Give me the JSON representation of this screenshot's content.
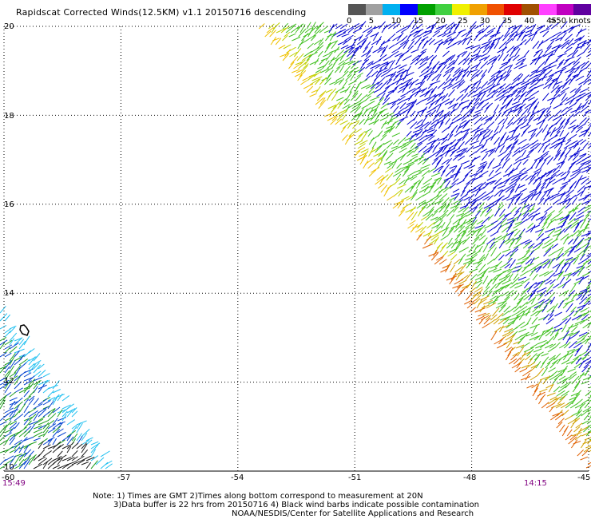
{
  "title": "Rapidscat Corrected Winds(12.5KM) v1.1 20150716 descending",
  "legend": {
    "colors": [
      "#555555",
      "#a0a0a0",
      "#00b0f0",
      "#0000ff",
      "#00a000",
      "#40d040",
      "#f0f000",
      "#f0a000",
      "#f05000",
      "#e00000",
      "#a05000",
      "#ff40ff",
      "#c000c0",
      "#6000a0"
    ],
    "labels": [
      "0",
      "5",
      "10",
      "15",
      "20",
      "25",
      "30",
      "35",
      "40",
      "45",
      ">50 knots"
    ]
  },
  "axes": {
    "x_ticks": [
      "-60",
      "-57",
      "-54",
      "-51",
      "-48",
      "-45"
    ],
    "y_ticks": [
      "10",
      "12",
      "14",
      "16",
      "18",
      "20"
    ],
    "lon_range": [
      -60,
      -45
    ],
    "lat_range": [
      10,
      20
    ]
  },
  "times": {
    "left": "15:49",
    "right": "14:15"
  },
  "notes": {
    "line1": "Note: 1) Times are GMT 2)Times along bottom correspond to measurement at 20N",
    "line2": "3)Data buffer is 22 hrs from 20150716 4) Black wind barbs indicate possible contamination",
    "line3": "NOAA/NESDIS/Center for Satellite Applications and Research"
  }
}
